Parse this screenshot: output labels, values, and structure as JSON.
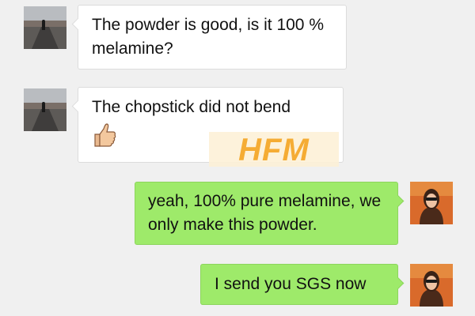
{
  "messages": [
    {
      "side": "incoming",
      "text": "The powder is good, is it 100 % melamine?"
    },
    {
      "side": "incoming",
      "text": "The chopstick did not bend",
      "emoji": "thumbs-up-icon"
    },
    {
      "side": "outgoing",
      "text": "yeah, 100% pure melamine, we only make this powder."
    },
    {
      "side": "outgoing",
      "text": "I send you SGS now"
    }
  ],
  "watermark": {
    "text": "HFM"
  },
  "colors": {
    "background": "#f0f0f0",
    "incoming_bubble": "#ffffff",
    "outgoing_bubble": "#9eea6a",
    "watermark": "#f5a623"
  }
}
